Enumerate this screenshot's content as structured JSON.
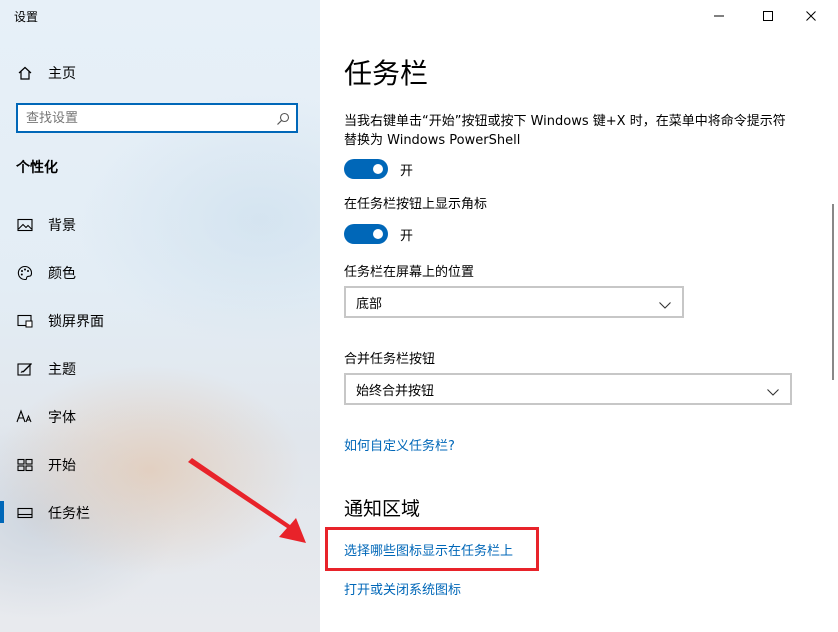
{
  "window": {
    "title": "设置",
    "controls": {
      "minimize_icon": "minimize-icon",
      "maximize_icon": "maximize-icon",
      "close_icon": "close-icon"
    }
  },
  "sidebar": {
    "home": {
      "label": "主页",
      "icon": "home-icon"
    },
    "search": {
      "placeholder": "查找设置",
      "value": "",
      "icon": "search-icon"
    },
    "section_title": "个性化",
    "items": [
      {
        "label": "背景",
        "icon": "picture-icon"
      },
      {
        "label": "颜色",
        "icon": "palette-icon"
      },
      {
        "label": "锁屏界面",
        "icon": "lock-screen-icon"
      },
      {
        "label": "主题",
        "icon": "theme-icon"
      },
      {
        "label": "字体",
        "icon": "font-icon"
      },
      {
        "label": "开始",
        "icon": "start-icon"
      },
      {
        "label": "任务栏",
        "icon": "taskbar-icon",
        "active": true
      }
    ]
  },
  "main": {
    "title": "任务栏",
    "settings": [
      {
        "description": "当我右键单击“开始”按钮或按下 Windows 键+X 时，在菜单中将命令提示符替换为 Windows PowerShell",
        "state": "开"
      },
      {
        "description": "在任务栏按钮上显示角标",
        "state": "开"
      }
    ],
    "position": {
      "label": "任务栏在屏幕上的位置",
      "value": "底部"
    },
    "combine": {
      "label": "合并任务栏按钮",
      "value": "始终合并按钮"
    },
    "help_link": "如何自定义任务栏?",
    "notification": {
      "heading": "通知区域",
      "links": [
        "选择哪些图标显示在任务栏上",
        "打开或关闭系统图标"
      ]
    }
  },
  "annotations": {
    "highlight_color": "#e8232a",
    "arrow_color": "#e8232a"
  },
  "colors": {
    "accent": "#0067b8"
  }
}
